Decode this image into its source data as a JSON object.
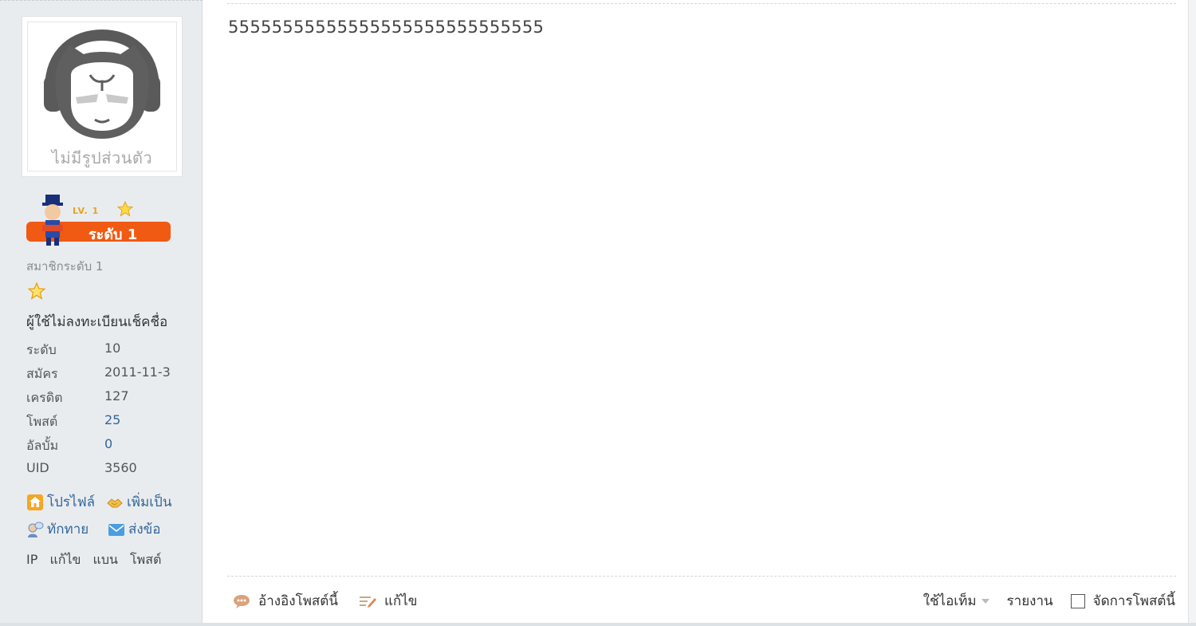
{
  "sidebar": {
    "avatar_caption": "ไม่มีรูปส่วนตัว",
    "rank_badge_text": "ระดับ 1",
    "rank_lv_text": "LV. 1",
    "member_level": "สมาชิกระดับ 1",
    "custom_title": "ผู้ใช้ไม่ลงทะเบียนเช็คชื่อ",
    "stats": [
      {
        "label": "ระดับ",
        "value": "10"
      },
      {
        "label": "สมัคร",
        "value": "2011-11-3"
      },
      {
        "label": "เครดิต",
        "value": "127"
      },
      {
        "label": "โพสต์",
        "value": "25"
      },
      {
        "label": "อัลบั้ม",
        "value": "0"
      },
      {
        "label": "UID",
        "value": "3560"
      }
    ],
    "actions": {
      "profile": "โปรไฟล์",
      "add_friend": "เพิ่มเป็น",
      "greet": "ทักทาย",
      "send_message": "ส่งข้อ"
    },
    "admin_links": [
      "IP",
      "แก้ไข",
      "แบน",
      "โพสต์"
    ],
    "icons": {
      "profile": "home-icon",
      "add_friend": "handshake-icon",
      "greet": "speech-person-icon",
      "send_message": "envelope-icon",
      "star": "star-icon"
    }
  },
  "post": {
    "content": "55555555555555555555555555555"
  },
  "footer": {
    "quote_label": "อ้างอิงโพสต์นี้",
    "edit_label": "แก้ไข",
    "use_item_label": "ใช้ไอเท็ม",
    "report_label": "รายงาน",
    "manage_label": "จัดการโพสต์นี้"
  },
  "colors": {
    "sidebar_bg": "#e9ecef",
    "rank_badge": "#f05a12",
    "link": "#336699"
  }
}
